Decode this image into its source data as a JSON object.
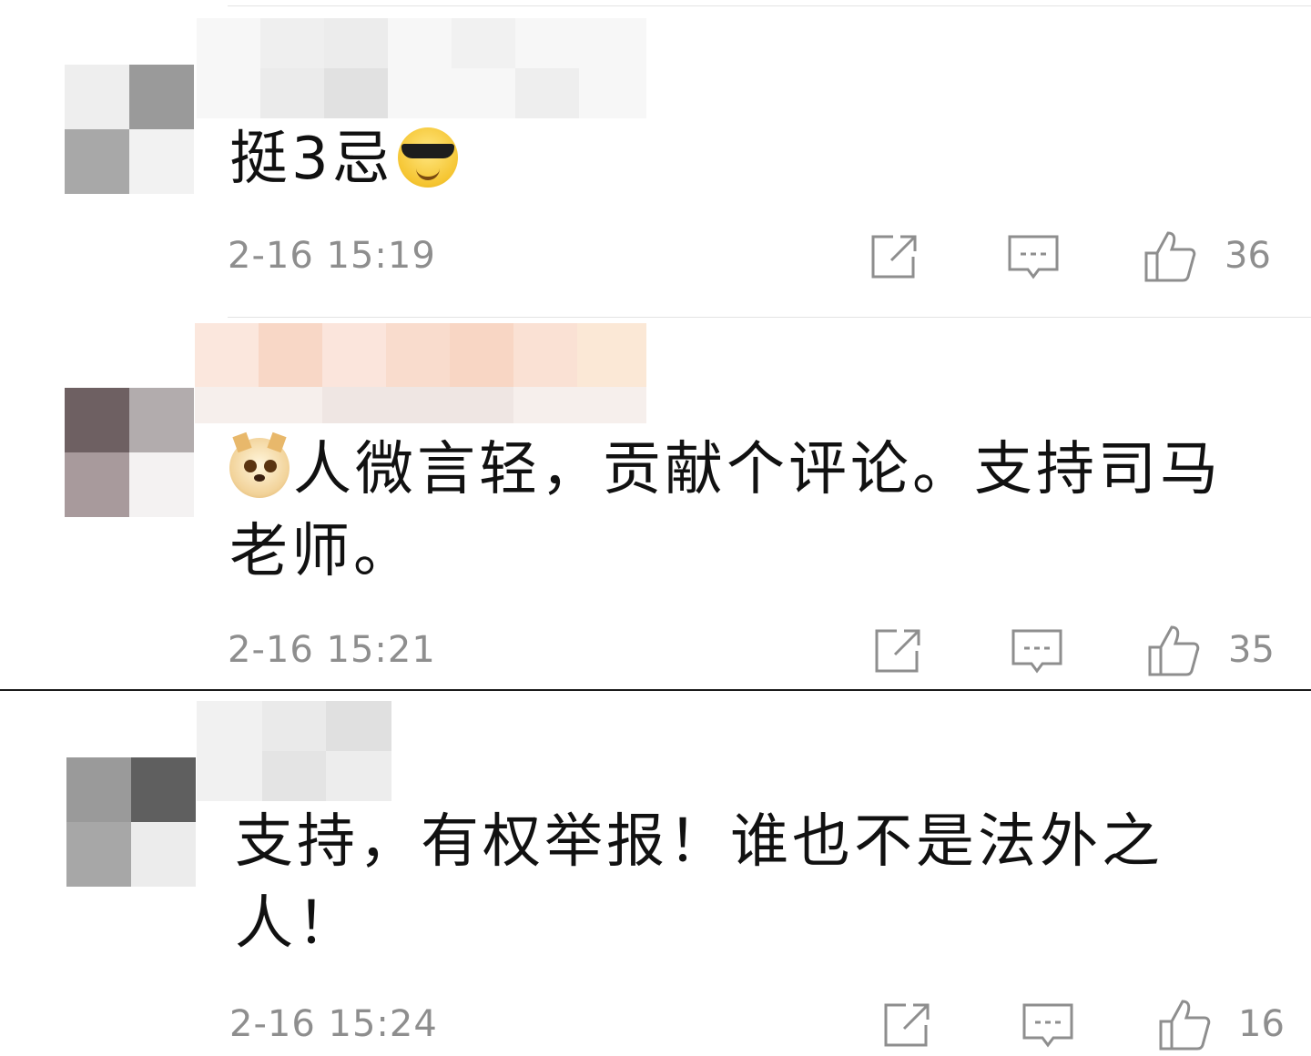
{
  "comments": [
    {
      "text": "挺3忌",
      "emoji": "cool-sunglasses-emoji",
      "time": "2-16 15:19",
      "likes": "36"
    },
    {
      "emoji": "doge-emoji",
      "text_line1": "人微言轻，贡献个评论。支持司马",
      "text_line2": "老师。",
      "time": "2-16 15:21",
      "likes": "35"
    },
    {
      "text_line1": "支持，有权举报！谁也不是法外之",
      "text_line2": "人！",
      "time": "2-16 15:24",
      "likes": "16"
    }
  ],
  "icons": {
    "share": "share-icon",
    "reply": "comment-icon",
    "like": "thumbs-up-icon"
  },
  "colors": {
    "meta_text": "#8e8e8e",
    "icon_stroke": "#8e8e8e",
    "divider_light": "#e3e3e3",
    "divider_dark": "#1a1a1a"
  }
}
